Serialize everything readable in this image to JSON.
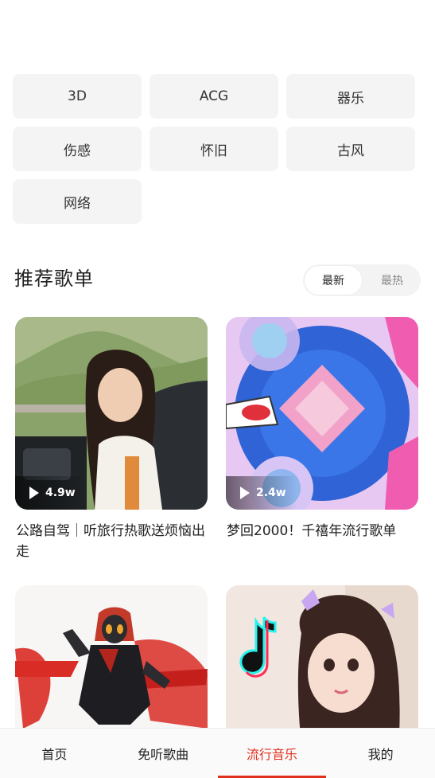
{
  "tags": [
    "3D",
    "ACG",
    "器乐",
    "伤感",
    "怀旧",
    "古风",
    "网络"
  ],
  "section": {
    "title": "推荐歌单",
    "sort_options": [
      "最新",
      "最热"
    ],
    "active_sort": "最新"
  },
  "playlists": [
    {
      "title": "公路自驾｜听旅行热歌送烦恼出走",
      "plays": "4.9w"
    },
    {
      "title": "梦回2000！千禧年流行歌单",
      "plays": "2.4w"
    },
    {
      "title": "",
      "plays": ""
    },
    {
      "title": "",
      "plays": ""
    }
  ],
  "bottom_nav": {
    "items": [
      "首页",
      "免听歌曲",
      "流行音乐",
      "我的"
    ],
    "active": "流行音乐"
  },
  "colors": {
    "accent": "#e0301e",
    "tag_bg": "#f4f4f4"
  }
}
